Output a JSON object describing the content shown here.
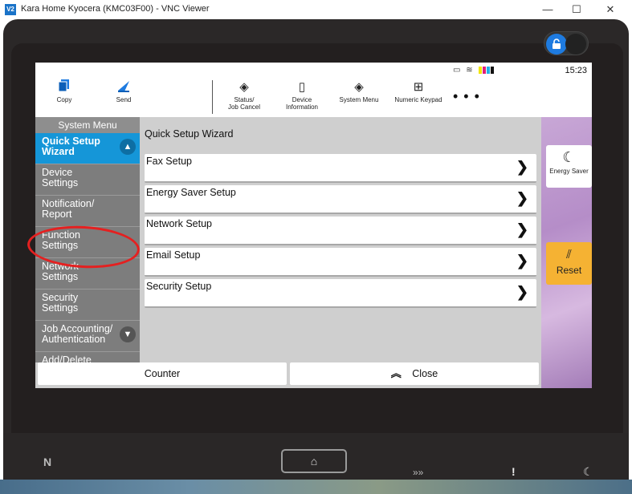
{
  "window": {
    "logo": "V2",
    "title": "Kara Home Kyocera (KMC03F00) - VNC Viewer",
    "controls": {
      "minimize": "—",
      "maximize": "☐",
      "close": "✕"
    }
  },
  "lock_toggle": {
    "icon": "🔓",
    "icon_name": "unlock-icon"
  },
  "status": {
    "time": "15:23",
    "icons": [
      "cast-icon",
      "wifi-icon",
      "toner-icon"
    ],
    "toner_colors": [
      "#f2e600",
      "#e0207a",
      "#20b0e8",
      "#111111"
    ]
  },
  "topbar": {
    "copy": {
      "label": "Copy",
      "icon": "copy-icon"
    },
    "send": {
      "label": "Send",
      "icon": "send-icon"
    },
    "status_job": {
      "label_line1": "Status/",
      "label_line2": "Job Cancel",
      "icon": "eye-icon"
    },
    "device_info": {
      "label_line1": "Device",
      "label_line2": "Information",
      "icon": "info-icon"
    },
    "system_menu": {
      "label": "System Menu",
      "icon": "diamond-icon"
    },
    "numeric_keypad": {
      "label": "Numeric Keypad",
      "icon": "keypad-icon"
    },
    "more": "• • •"
  },
  "sidebar": {
    "header": "System Menu",
    "items": [
      {
        "line1": "Quick Setup",
        "line2": "Wizard",
        "active": true,
        "chevron": "up"
      },
      {
        "line1": "Device",
        "line2": "Settings"
      },
      {
        "line1": "Notification/",
        "line2": "Report"
      },
      {
        "line1": "Function",
        "line2": "Settings"
      },
      {
        "line1": "Network",
        "line2": "Settings"
      },
      {
        "line1": "Security",
        "line2": "Settings"
      },
      {
        "line1": "Job Accounting/",
        "line2": "Authentication",
        "chevron": "down"
      },
      {
        "line1": "Add/Delete",
        "line2": ""
      }
    ]
  },
  "main": {
    "title": "Quick Setup Wizard",
    "items": [
      {
        "label": "Fax Setup"
      },
      {
        "label": "Energy Saver Setup"
      },
      {
        "label": "Network Setup"
      },
      {
        "label": "Email Setup"
      },
      {
        "label": "Security Setup"
      }
    ],
    "arrow": "❯"
  },
  "right_panel": {
    "energy_saver": {
      "label": "Energy Saver",
      "icon": "moon-icon"
    },
    "reset": {
      "label": "Reset",
      "icon": "reset-icon"
    }
  },
  "bottom": {
    "counter": "Counter",
    "close": "Close",
    "close_icon": "double-chevron-up-icon"
  },
  "hardware": {
    "nfc_icon": "nfc-icon",
    "home_icon": "home-icon",
    "data_icon": "data-icon",
    "attention_icon": "attention-icon",
    "sleep_icon": "sleep-icon"
  },
  "colors": {
    "accent_blue": "#1596d8",
    "reset_orange": "#f5b233",
    "annotation_red": "#e52020"
  }
}
